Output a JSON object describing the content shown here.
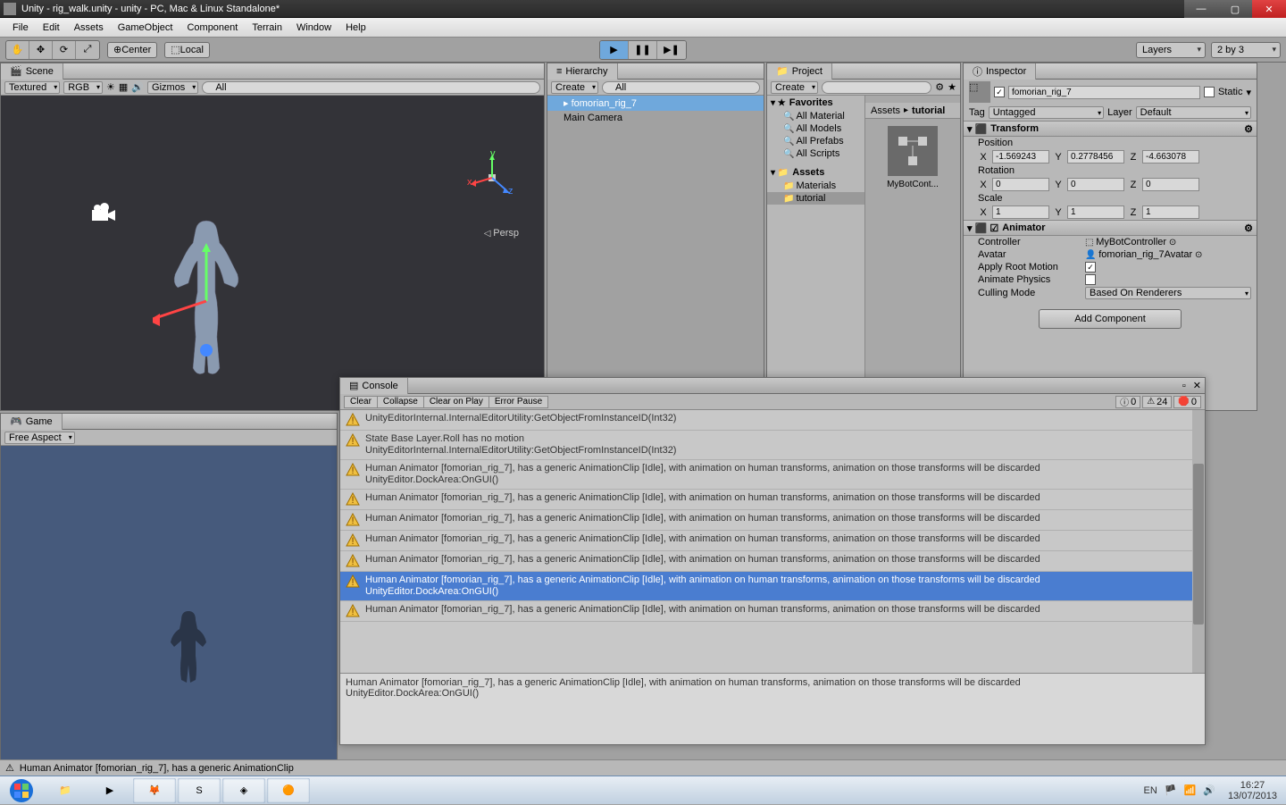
{
  "title": "Unity - rig_walk.unity - unity - PC, Mac & Linux Standalone*",
  "menu": [
    "File",
    "Edit",
    "Assets",
    "GameObject",
    "Component",
    "Terrain",
    "Window",
    "Help"
  ],
  "toolbar": {
    "center": "Center",
    "local": "Local",
    "layers": "Layers",
    "layout": "2 by 3"
  },
  "scene": {
    "tab": "Scene",
    "shading": "Textured",
    "rendermode": "RGB",
    "gizmos": "Gizmos",
    "search_placeholder": "All",
    "persp": "Persp"
  },
  "hierarchy": {
    "tab": "Hierarchy",
    "create": "Create",
    "search_placeholder": "All",
    "items": [
      "fomorian_rig_7",
      "Main Camera"
    ]
  },
  "project": {
    "tab": "Project",
    "create": "Create",
    "favorites": "Favorites",
    "fav_items": [
      "All Material",
      "All Models",
      "All Prefabs",
      "All Scripts"
    ],
    "assets": "Assets",
    "asset_folders": [
      "Materials",
      "tutorial"
    ],
    "breadcrumb": [
      "Assets",
      "tutorial"
    ],
    "tile_label": "MyBotCont..."
  },
  "inspector": {
    "tab": "Inspector",
    "name": "fomorian_rig_7",
    "static": "Static",
    "tag_lbl": "Tag",
    "tag_val": "Untagged",
    "layer_lbl": "Layer",
    "layer_val": "Default",
    "transform": "Transform",
    "position": "Position",
    "rotation": "Rotation",
    "scale": "Scale",
    "pos": {
      "x": "-1.569243",
      "y": "0.2778456",
      "z": "-4.663078"
    },
    "rot": {
      "x": "0",
      "y": "0",
      "z": "0"
    },
    "scl": {
      "x": "1",
      "y": "1",
      "z": "1"
    },
    "animator": "Animator",
    "controller_lbl": "Controller",
    "controller_val": "MyBotController",
    "avatar_lbl": "Avatar",
    "avatar_val": "fomorian_rig_7Avatar",
    "rootmotion_lbl": "Apply Root Motion",
    "animphys_lbl": "Animate Physics",
    "culling_lbl": "Culling Mode",
    "culling_val": "Based On Renderers",
    "add_component": "Add Component"
  },
  "game": {
    "tab": "Game",
    "aspect": "Free Aspect"
  },
  "console": {
    "tab": "Console",
    "clear": "Clear",
    "collapse": "Collapse",
    "clear_on_play": "Clear on Play",
    "error_pause": "Error Pause",
    "info_count": "0",
    "warn_count": "24",
    "error_count": "0",
    "entries": [
      {
        "l1": "UnityEditorInternal.InternalEditorUtility:GetObjectFromInstanceID(Int32)",
        "l2": ""
      },
      {
        "l1": "State Base Layer.Roll has no motion",
        "l2": "UnityEditorInternal.InternalEditorUtility:GetObjectFromInstanceID(Int32)"
      },
      {
        "l1": "Human Animator [fomorian_rig_7], has a generic AnimationClip [Idle],  with animation on human transforms, animation on those transforms will be discarded",
        "l2": "UnityEditor.DockArea:OnGUI()"
      },
      {
        "l1": "Human Animator [fomorian_rig_7], has a generic AnimationClip [Idle],  with animation on human transforms, animation on those transforms will be discarded",
        "l2": ""
      },
      {
        "l1": "Human Animator [fomorian_rig_7], has a generic AnimationClip [Idle],  with animation on human transforms, animation on those transforms will be discarded",
        "l2": ""
      },
      {
        "l1": "Human Animator [fomorian_rig_7], has a generic AnimationClip [Idle],  with animation on human transforms, animation on those transforms will be discarded",
        "l2": ""
      },
      {
        "l1": "Human Animator [fomorian_rig_7], has a generic AnimationClip [Idle],  with animation on human transforms, animation on those transforms will be discarded",
        "l2": ""
      },
      {
        "l1": "Human Animator [fomorian_rig_7], has a generic AnimationClip [Idle],  with animation on human transforms, animation on those transforms will be discarded",
        "l2": "UnityEditor.DockArea:OnGUI()",
        "sel": true
      },
      {
        "l1": "Human Animator [fomorian_rig_7], has a generic AnimationClip [Idle],  with animation on human transforms, animation on those transforms will be discarded",
        "l2": ""
      }
    ],
    "detail_l1": "Human Animator [fomorian_rig_7], has a generic AnimationClip [Idle],  with animation on human transforms, animation on those transforms will be discarded",
    "detail_l2": "UnityEditor.DockArea:OnGUI()"
  },
  "statusbar": "Human Animator [fomorian_rig_7], has a generic AnimationClip",
  "taskbar": {
    "lang": "EN",
    "time": "16:27",
    "date": "13/07/2013"
  }
}
